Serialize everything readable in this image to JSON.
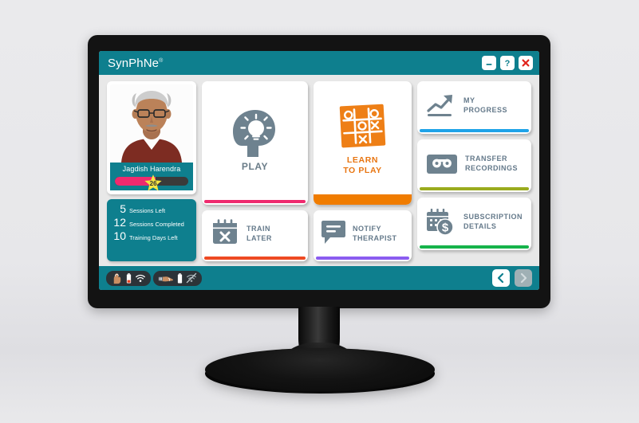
{
  "window": {
    "logo": "SynPhNe",
    "logo_mark": "®",
    "minimize_label": "Minimize",
    "help_label": "Help",
    "close_label": "Close",
    "titlebar_color": "#0e7f8e"
  },
  "profile": {
    "name": "Jagdish Harendra",
    "avatar_alt": "Portrait of Jagdish Harendra",
    "progress_percent": 55,
    "badge_value": "26",
    "progress_fill_color": "#ef2a6e",
    "progress_track_color": "#3a3a3a",
    "badge_color": "#f5e642",
    "stats": [
      {
        "value": "5",
        "label": "Sessions Left"
      },
      {
        "value": "12",
        "label": "Sessions Completed"
      },
      {
        "value": "10",
        "label": "Training Days Left"
      }
    ]
  },
  "tiles": {
    "play": {
      "label": "PLAY",
      "icon": "head-lightbulb-icon",
      "accent": "#ef2a6e"
    },
    "learn_to_play": {
      "label": "LEARN\nTO PLAY",
      "line1": "LEARN",
      "line2": "TO PLAY",
      "icon": "tic-tac-toe-icon",
      "accent": "#f07c00",
      "icon_color": "#ee7f16"
    },
    "my_progress": {
      "line1": "MY",
      "line2": "PROGRESS",
      "icon": "chart-arrow-up-icon",
      "accent": "#1fa3e8"
    },
    "transfer_recordings": {
      "line1": "TRANSFER",
      "line2": "RECORDINGS",
      "icon": "cassette-tape-icon",
      "accent": "#9aab1e"
    },
    "train_later": {
      "line1": "TRAIN",
      "line2": "LATER",
      "icon": "calendar-x-icon",
      "accent": "#ee4a23"
    },
    "notify_therapist": {
      "line1": "NOTIFY",
      "line2": "THERAPIST",
      "icon": "speech-bubble-icon",
      "accent": "#8b5cf0"
    },
    "subscription_details": {
      "line1": "SUBSCRIPTION",
      "line2": "DETAILS",
      "icon": "calendar-dollar-icon",
      "accent": "#16b34a"
    }
  },
  "statusbar": {
    "device_groups": [
      {
        "name": "hand-device",
        "icons": [
          "hand-glove-icon",
          "battery-low-icon",
          "wifi-connected-icon"
        ],
        "battery_state": "low",
        "wifi_state": "connected"
      },
      {
        "name": "arm-device",
        "icons": [
          "forearm-band-icon",
          "battery-full-icon",
          "wifi-disconnected-icon"
        ],
        "battery_state": "full",
        "wifi_state": "disconnected"
      }
    ],
    "back_label": "Back",
    "forward_label": "Forward",
    "forward_enabled": false
  }
}
